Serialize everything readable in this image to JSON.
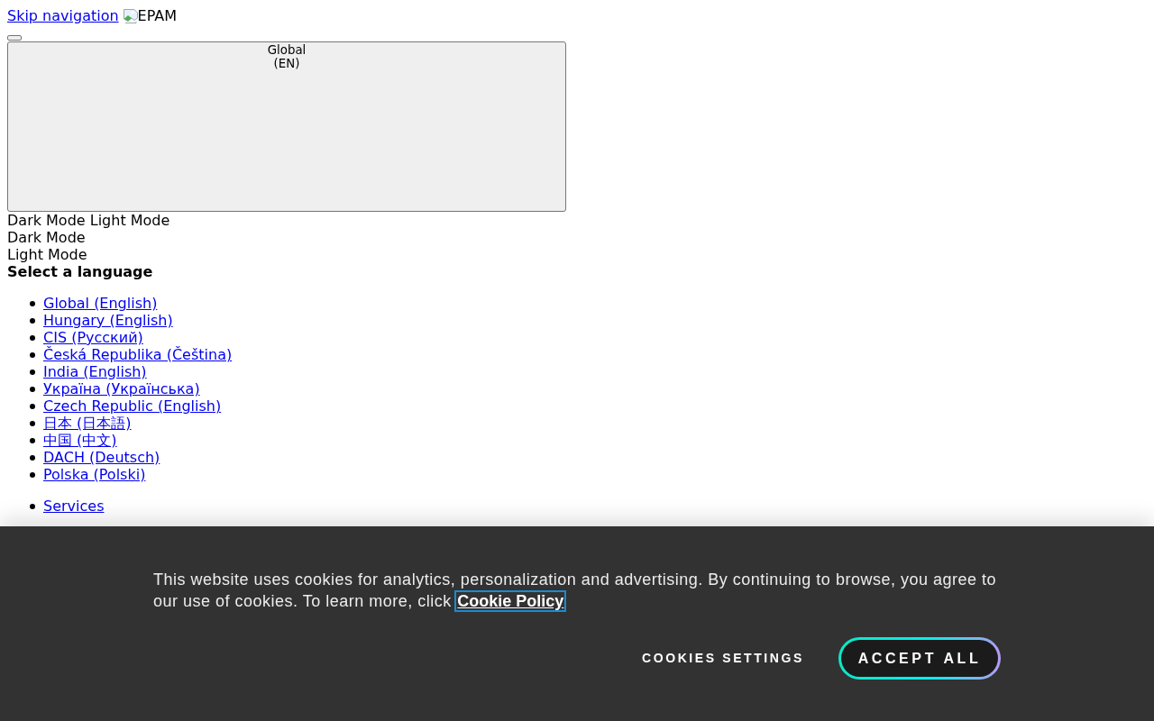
{
  "skip_link": "Skip navigation",
  "logo_image": {
    "alt": "EPAM"
  },
  "region_button": {
    "label": "Global",
    "sublabel": "(EN)"
  },
  "theme_switch": {
    "inline_labels": [
      "Dark Mode",
      "Light Mode"
    ],
    "labels": [
      "Dark Mode",
      "Light Mode"
    ]
  },
  "language_heading": "Select a language",
  "languages": [
    "Global (English)",
    "Hungary (English)",
    "CIS (Русский)",
    "Česká Republika (Čeština)",
    "India (English)",
    "Україна (Українська)",
    "Czech Republic (English)",
    "日本 (日本語)",
    "中国 (中文)",
    "DACH (Deutsch)",
    "Polska (Polski)"
  ],
  "nav": [
    {
      "label": "Services"
    }
  ],
  "cookie_banner": {
    "message": "This website uses cookies for analytics, personalization and advertising. By continuing to browse, you agree to our use of cookies. To learn more, click",
    "policy_link": {
      "label": "Cookie Policy",
      "focused": true
    },
    "buttons": [
      {
        "label": "COOKIES SETTINGS",
        "kind": "text"
      },
      {
        "label": "ACCEPT ALL",
        "kind": "primary"
      }
    ]
  }
}
